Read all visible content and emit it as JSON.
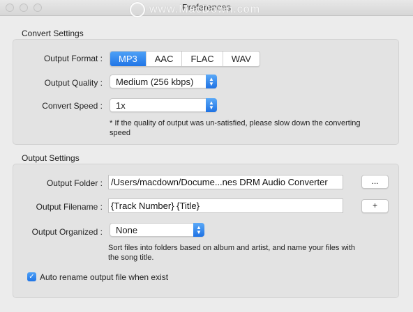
{
  "window": {
    "title": "Preferences"
  },
  "watermark": {
    "text": "www.MacDown.com"
  },
  "convert_settings": {
    "section_title": "Convert Settings",
    "output_format": {
      "label": "Output Format :",
      "options": [
        "MP3",
        "AAC",
        "FLAC",
        "WAV"
      ],
      "selected": "MP3"
    },
    "output_quality": {
      "label": "Output Quality :",
      "value": "Medium (256 kbps)"
    },
    "convert_speed": {
      "label": "Convert Speed :",
      "value": "1x"
    },
    "note_line1": "* If the quality of output was un-satisfied, please slow down the converting",
    "note_line2": "speed"
  },
  "output_settings": {
    "section_title": "Output Settings",
    "output_folder": {
      "label": "Output Folder :",
      "value": "/Users/macdown/Docume...nes DRM Audio Converter",
      "browse_label": "..."
    },
    "output_filename": {
      "label": "Output Filename :",
      "value": "{Track Number} {Title}",
      "add_label": "+"
    },
    "output_organized": {
      "label": "Output Organized :",
      "value": "None"
    },
    "organized_note_line1": "Sort files into folders based on album and artist, and name your files with",
    "organized_note_line2": "the song title.",
    "auto_rename": {
      "label": "Auto rename output file when exist",
      "checked": true
    }
  },
  "colors": {
    "accent": "#2f86f0",
    "window_bg": "#ececec",
    "group_bg": "#e3e3e3"
  },
  "icons": {
    "popup": "chevron-up-down-icon",
    "check": "checkmark-icon"
  }
}
